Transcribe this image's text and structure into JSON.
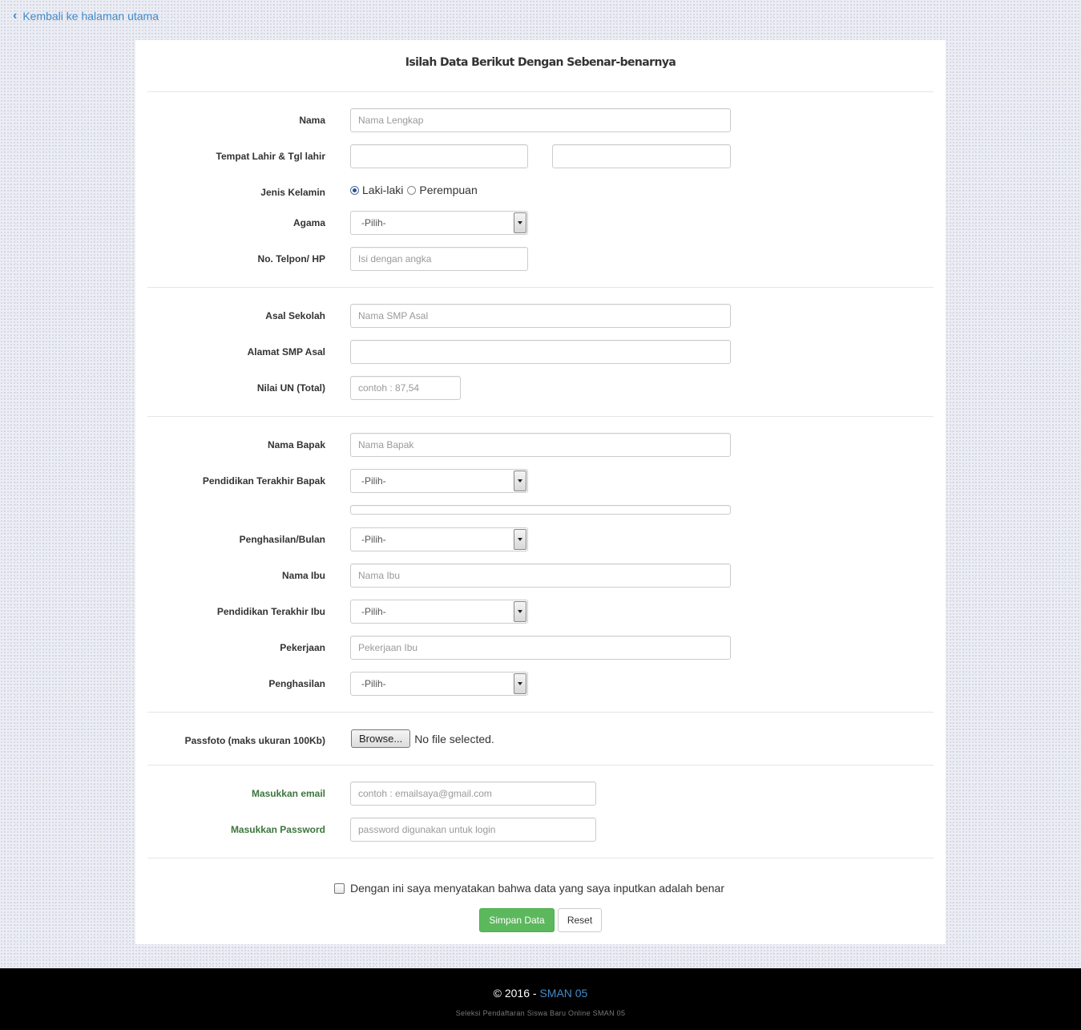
{
  "nav": {
    "back_label": "Kembali ke halaman utama"
  },
  "form": {
    "title": "Isilah Data Berikut Dengan Sebenar-benarnya",
    "nama": {
      "label": "Nama",
      "placeholder": "Nama Lengkap"
    },
    "ttl": {
      "label": "Tempat Lahir & Tgl lahir"
    },
    "jenis_kelamin": {
      "label": "Jenis Kelamin",
      "options": [
        "Laki-laki",
        "Perempuan"
      ],
      "selected": "Laki-laki"
    },
    "agama": {
      "label": "Agama",
      "value": "-Pilih-"
    },
    "telpon": {
      "label": "No. Telpon/ HP",
      "placeholder": "Isi dengan angka"
    },
    "asal_sekolah": {
      "label": "Asal Sekolah",
      "placeholder": "Nama SMP Asal"
    },
    "alamat_smp": {
      "label": "Alamat SMP Asal"
    },
    "nilai_un": {
      "label": "Nilai UN (Total)",
      "placeholder": "contoh : 87,54"
    },
    "nama_bapak": {
      "label": "Nama Bapak",
      "placeholder": "Nama Bapak"
    },
    "pendidikan_bapak": {
      "label": "Pendidikan Terakhir Bapak",
      "value": "-Pilih-"
    },
    "penghasilan_bulan": {
      "label": "Penghasilan/Bulan",
      "value": "-Pilih-"
    },
    "nama_ibu": {
      "label": "Nama Ibu",
      "placeholder": "Nama Ibu"
    },
    "pendidikan_ibu": {
      "label": "Pendidikan Terakhir Ibu",
      "value": "-Pilih-"
    },
    "pekerjaan": {
      "label": "Pekerjaan",
      "placeholder": "Pekerjaan Ibu"
    },
    "penghasilan": {
      "label": "Penghasilan",
      "value": "-Pilih-"
    },
    "passfoto": {
      "label": "Passfoto (maks ukuran 100Kb)",
      "button": "Browse...",
      "status": "No file selected."
    },
    "email": {
      "label": "Masukkan email",
      "placeholder": "contoh : emailsaya@gmail.com"
    },
    "password": {
      "label": "Masukkan Password",
      "placeholder": "password digunakan untuk login"
    },
    "agreement": "Dengan ini saya menyatakan bahwa data yang saya inputkan adalah benar",
    "submit_label": "Simpan Data",
    "reset_label": "Reset"
  },
  "footer": {
    "copyright": "© 2016 - ",
    "brand": "SMAN 05",
    "subtitle": "Seleksi Pendaftaran Siswa Baru Online SMAN 05"
  },
  "colors": {
    "link": "#428bca",
    "success": "#5cb85c",
    "label_green": "#3c763d"
  }
}
